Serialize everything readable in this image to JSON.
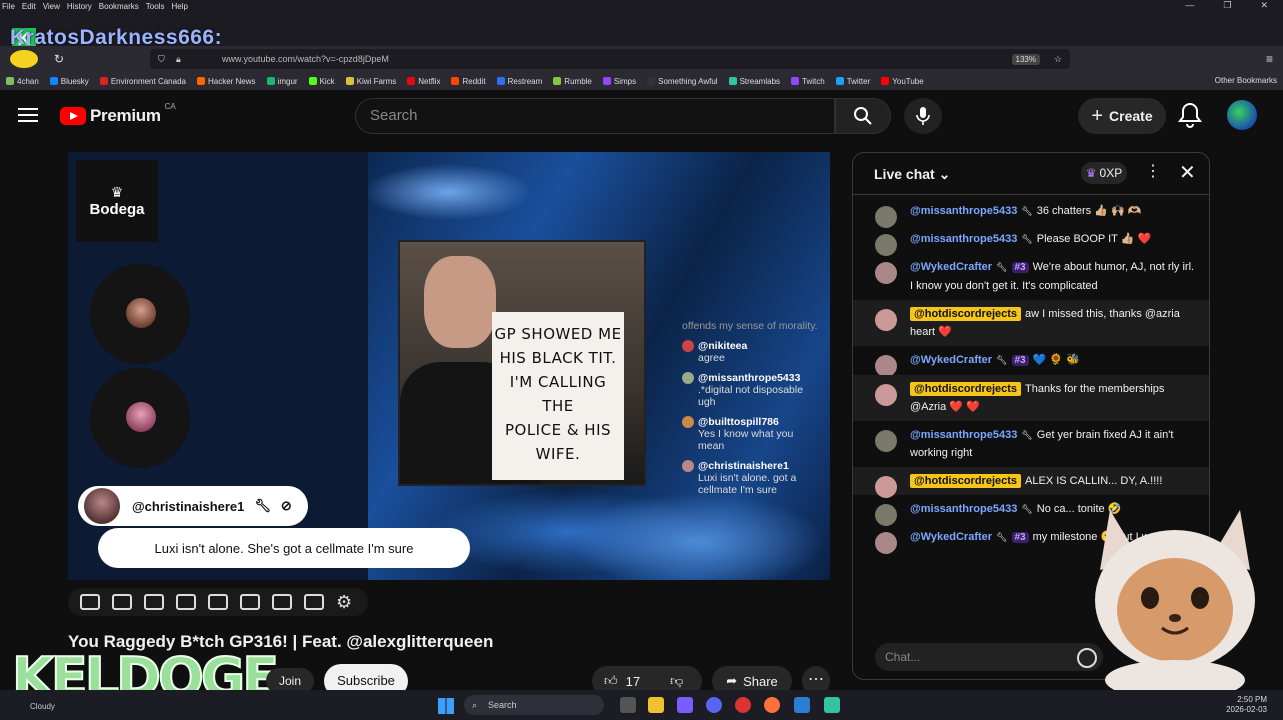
{
  "browser": {
    "menu": [
      "File",
      "Edit",
      "View",
      "History",
      "Bookmarks",
      "Tools",
      "Help"
    ],
    "overlay_name": "KratosDarkness666:",
    "url": "www.youtube.com/watch?v=-cpzd8jDpeM",
    "zoom": "133%",
    "bookmarks": [
      {
        "label": "4chan",
        "color": "#7fbf5f"
      },
      {
        "label": "Bluesky",
        "color": "#1185fe"
      },
      {
        "label": "Environment Canada",
        "color": "#d22"
      },
      {
        "label": "Hacker News",
        "color": "#ff6600"
      },
      {
        "label": "imgur",
        "color": "#1bb76e"
      },
      {
        "label": "Kick",
        "color": "#53fc18"
      },
      {
        "label": "Kiwi Farms",
        "color": "#d9c23b"
      },
      {
        "label": "Netflix",
        "color": "#e50914"
      },
      {
        "label": "Reddit",
        "color": "#ff4500"
      },
      {
        "label": "Restream",
        "color": "#2d6ff7"
      },
      {
        "label": "Rumble",
        "color": "#85c742"
      },
      {
        "label": "Simps",
        "color": "#9146ff"
      },
      {
        "label": "Something Awful",
        "color": "#333"
      },
      {
        "label": "Streamlabs",
        "color": "#31c3a2"
      },
      {
        "label": "Twitch",
        "color": "#9146ff"
      },
      {
        "label": "Twitter",
        "color": "#1da1f2"
      },
      {
        "label": "YouTube",
        "color": "#ff0000"
      }
    ],
    "other_bookmarks": "Other Bookmarks"
  },
  "youtube": {
    "logo_text": "Premium",
    "region": "CA",
    "search_placeholder": "Search",
    "create_label": "Create"
  },
  "video": {
    "channel_logo": "Bodega",
    "sign_lines": [
      "GP SHOWED ME",
      "HIS BLACK TIT.",
      "I'M CALLING THE",
      "POLICE & HIS",
      "WIFE."
    ],
    "chat_overlay": [
      {
        "user": "",
        "text": "offends my sense of morality.",
        "color": "#888"
      },
      {
        "user": "@nikiteea",
        "text": "agree",
        "color": "#c44"
      },
      {
        "user": "@missanthrope5433",
        "text": ".*digital not disposable ugh",
        "color": "#bbb"
      },
      {
        "user": "@builttospill786",
        "text": "Yes I know what you mean",
        "color": "#c84"
      },
      {
        "user": "@christinaishere1",
        "text": "Luxi isn't alone. got a cellmate I'm sure",
        "color": "#b88"
      }
    ],
    "caption_user": "@christinaishere1",
    "caption_text": "Luxi isn't alone. She's got a cellmate I'm sure",
    "title": "You Raggedy B*tch  GP316! | Feat. @alexglitterqueen",
    "join": "Join",
    "subscribe": "Subscribe",
    "likes": "17",
    "share": "Share",
    "overlay_brand": "KELDOGE"
  },
  "chat": {
    "title": "Live chat",
    "xp": "0XP",
    "input_placeholder": "Chat...",
    "messages": [
      {
        "author": "@missanthrope5433",
        "badge": "",
        "text": "36 chatters 👍🏼 🙌🏼 🫶🏼",
        "member": false,
        "highlight": false,
        "avatar": "#7a7a6a"
      },
      {
        "author": "@missanthrope5433",
        "badge": "",
        "text": "Please BOOP IT 👍🏼 ❤️",
        "member": false,
        "highlight": false,
        "avatar": "#7a7a6a"
      },
      {
        "author": "@WykedCrafter",
        "badge": "#3",
        "text": "We're about humor, AJ, not rly irl. I know you don't get it. It's complicated",
        "member": false,
        "highlight": false,
        "avatar": "#a88"
      },
      {
        "author": "@hotdiscordrejects",
        "badge": "",
        "text": "aw I missed this, thanks @azria heart ❤️",
        "member": true,
        "highlight": true,
        "avatar": "#c99"
      },
      {
        "author": "@WykedCrafter",
        "badge": "#3",
        "text": "💙 🌻 🐝",
        "member": false,
        "highlight": false,
        "avatar": "#a88"
      },
      {
        "author": "@hotdiscordrejects",
        "badge": "",
        "text": "Thanks for the memberships @Azria ❤️ ❤️",
        "member": true,
        "highlight": true,
        "avatar": "#c99"
      },
      {
        "author": "@missanthrope5433",
        "badge": "",
        "text": "Get yer brain fixed AJ it ain't working right",
        "member": false,
        "highlight": false,
        "avatar": "#7a7a6a"
      },
      {
        "author": "@hotdiscordrejects",
        "badge": "",
        "text": "ALEX IS CALLIN... DY, A.!!!!",
        "member": true,
        "highlight": true,
        "avatar": "#c99"
      },
      {
        "author": "@missanthrope5433",
        "badge": "",
        "text": "No ca... tonite 🤣",
        "member": false,
        "highlight": false,
        "avatar": "#7a7a6a"
      },
      {
        "author": "@WykedCrafter",
        "badge": "#3",
        "text": "my milestone 😶 but I won't def...",
        "member": false,
        "highlight": false,
        "avatar": "#a88"
      }
    ]
  },
  "taskbar": {
    "weather": "Cloudy",
    "search": "Search",
    "time": "2:50 PM",
    "date": "2026-02-03"
  }
}
